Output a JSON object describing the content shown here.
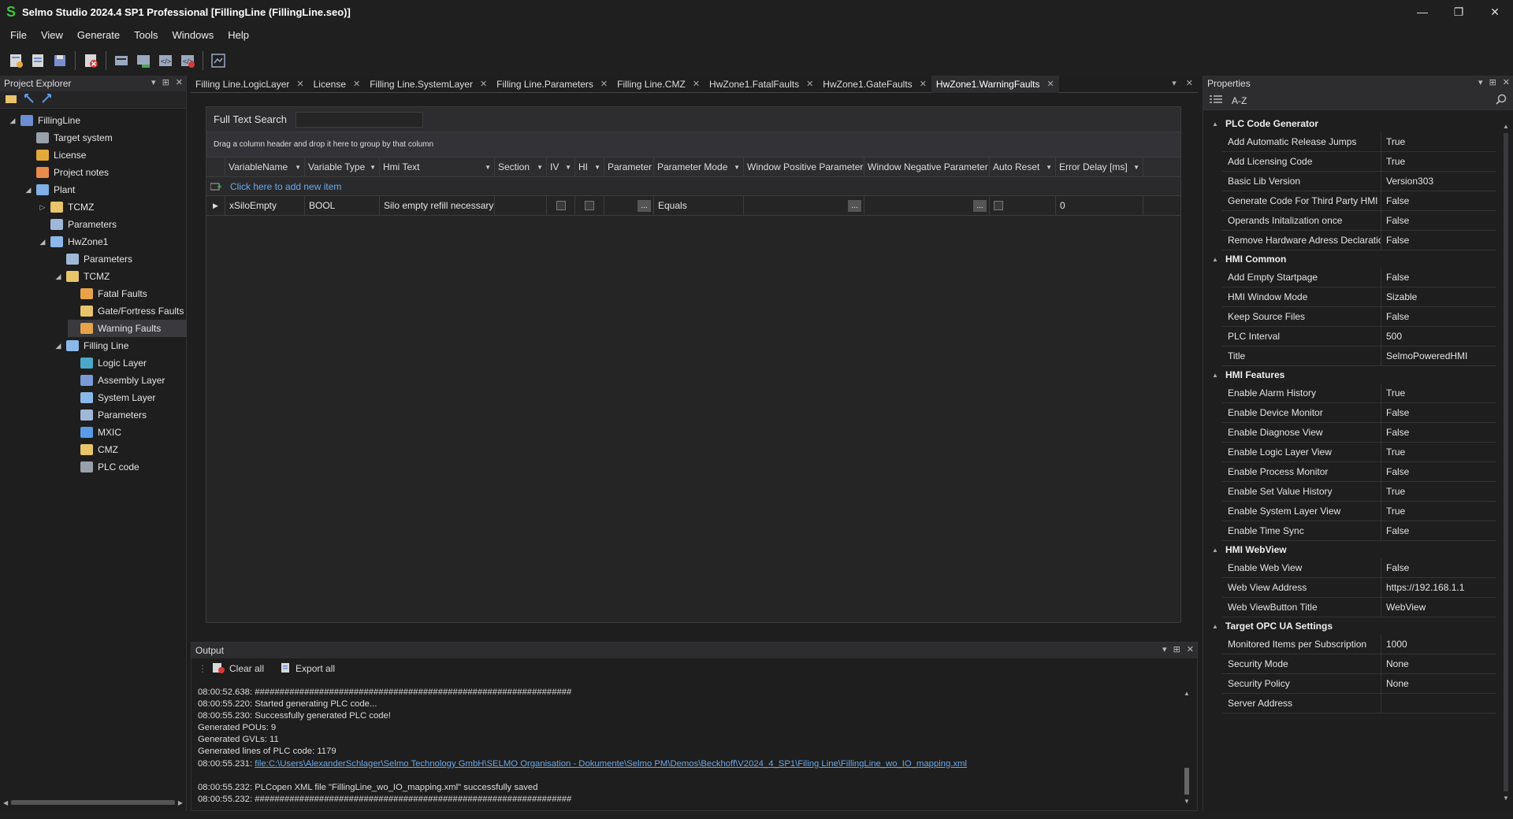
{
  "titlebar": {
    "title": "Selmo Studio 2024.4 SP1 Professional  [FillingLine (FillingLine.seo)]",
    "logo": "S"
  },
  "menu": [
    "File",
    "View",
    "Generate",
    "Tools",
    "Windows",
    "Help"
  ],
  "project_explorer": {
    "title": "Project Explorer",
    "tree": [
      {
        "label": "FillingLine",
        "level": 0,
        "exp": "◢",
        "icon": "project-icon",
        "color": "#6c8fd4"
      },
      {
        "label": "Target system",
        "level": 1,
        "exp": "",
        "icon": "target-system-icon",
        "color": "#9aa0aa"
      },
      {
        "label": "License",
        "level": 1,
        "exp": "",
        "icon": "key-icon",
        "color": "#e3a93a"
      },
      {
        "label": "Project notes",
        "level": 1,
        "exp": "",
        "icon": "notes-icon",
        "color": "#e88a4a"
      },
      {
        "label": "Plant",
        "level": 1,
        "exp": "◢",
        "icon": "plant-icon",
        "color": "#7fb0e6"
      },
      {
        "label": "TCMZ",
        "level": 2,
        "exp": "▷",
        "icon": "folder-icon",
        "color": "#e8c46a"
      },
      {
        "label": "Parameters",
        "level": 2,
        "exp": "",
        "icon": "parameters-icon",
        "color": "#9fb8d8"
      },
      {
        "label": "HwZone1",
        "level": 2,
        "exp": "◢",
        "icon": "zone-icon",
        "color": "#8ab8e8"
      },
      {
        "label": "Parameters",
        "level": 3,
        "exp": "",
        "icon": "parameters-icon",
        "color": "#9fb8d8"
      },
      {
        "label": "TCMZ",
        "level": 3,
        "exp": "◢",
        "icon": "folder-icon",
        "color": "#e8c46a"
      },
      {
        "label": "Fatal Faults",
        "level": 4,
        "exp": "",
        "icon": "fatal-faults-icon",
        "color": "#e8a24a"
      },
      {
        "label": "Gate/Fortress Faults",
        "level": 4,
        "exp": "",
        "icon": "gate-faults-icon",
        "color": "#e8c46a"
      },
      {
        "label": "Warning Faults",
        "level": 4,
        "exp": "",
        "icon": "warning-faults-icon",
        "color": "#e8a24a",
        "selected": true
      },
      {
        "label": "Filling Line",
        "level": 3,
        "exp": "◢",
        "icon": "line-icon",
        "color": "#8ab8e8"
      },
      {
        "label": "Logic Layer",
        "level": 4,
        "exp": "",
        "icon": "logic-layer-icon",
        "color": "#4aa8c8"
      },
      {
        "label": "Assembly Layer",
        "level": 4,
        "exp": "",
        "icon": "assembly-layer-icon",
        "color": "#7a9ad8"
      },
      {
        "label": "System Layer",
        "level": 4,
        "exp": "",
        "icon": "system-layer-icon",
        "color": "#8ab8e8"
      },
      {
        "label": "Parameters",
        "level": 4,
        "exp": "",
        "icon": "parameters-icon",
        "color": "#9fb8d8"
      },
      {
        "label": "MXIC",
        "level": 4,
        "exp": "",
        "icon": "mxic-icon",
        "color": "#5a9ae8"
      },
      {
        "label": "CMZ",
        "level": 4,
        "exp": "",
        "icon": "folder-icon",
        "color": "#e8c46a"
      },
      {
        "label": "PLC code",
        "level": 4,
        "exp": "",
        "icon": "plc-code-icon",
        "color": "#9aa0aa"
      }
    ]
  },
  "tabs": [
    {
      "label": "Filling Line.LogicLayer"
    },
    {
      "label": "License"
    },
    {
      "label": "Filling Line.SystemLayer"
    },
    {
      "label": "Filling Line.Parameters"
    },
    {
      "label": "Filling Line.CMZ"
    },
    {
      "label": "HwZone1.FatalFaults"
    },
    {
      "label": "HwZone1.GateFaults"
    },
    {
      "label": "HwZone1.WarningFaults",
      "active": true
    }
  ],
  "grid": {
    "search_label": "Full Text Search",
    "group_hint": "Drag a column header and drop it here to group by that column",
    "add_label": "Click here to add new item",
    "columns": [
      "VariableName",
      "Variable Type",
      "Hmi Text",
      "Section",
      "IV",
      "HI",
      "Parameter",
      "Parameter Mode",
      "Window Positive Parameter",
      "Window Negative Parameter",
      "Auto Reset",
      "Error Delay [ms]"
    ],
    "row": {
      "variable_name": "xSiloEmpty",
      "variable_type": "BOOL",
      "hmi_text": "Silo empty refill necessary",
      "parameter_mode": "Equals",
      "error_delay": "0",
      "dots": "..."
    }
  },
  "output": {
    "title": "Output",
    "clear_all": "Clear all",
    "export_all": "Export all",
    "lines": [
      {
        "text": "08:00:52.638: ################################################################"
      },
      {
        "text": "08:00:55.220: Started generating PLC code..."
      },
      {
        "text": "08:00:55.230: Successfully generated PLC code!"
      },
      {
        "text": "Generated POUs: 9"
      },
      {
        "text": "Generated GVLs: 11"
      },
      {
        "text": "Generated lines of PLC code: 1179"
      },
      {
        "text": "08:00:55.231: ",
        "link": "file:C:\\Users\\AlexanderSchlager\\Selmo Technology GmbH\\SELMO Organisation - Dokumente\\Selmo PM\\Demos\\Beckhoff\\V2024_4_SP1\\Filing Line\\FillingLine_wo_IO_mapping.xml"
      },
      {
        "text": ""
      },
      {
        "text": "08:00:55.232: PLCopen XML file \"FillingLine_wo_IO_mapping.xml\" successfully saved"
      },
      {
        "text": "08:00:55.232: ################################################################"
      }
    ]
  },
  "properties": {
    "title": "Properties",
    "sort_label": "A-Z",
    "categories": [
      {
        "name": "PLC Code Generator",
        "rows": [
          [
            "Add Automatic Release Jumps",
            "True"
          ],
          [
            "Add Licensing Code",
            "True"
          ],
          [
            "Basic Lib Version",
            "Version303"
          ],
          [
            "Generate Code For Third Party HMI",
            "False"
          ],
          [
            "Operands Initalization once",
            "False"
          ],
          [
            "Remove Hardware Adress Declaration",
            "False"
          ]
        ]
      },
      {
        "name": "HMI Common",
        "rows": [
          [
            "Add Empty Startpage",
            "False"
          ],
          [
            "HMI Window Mode",
            "Sizable"
          ],
          [
            "Keep Source Files",
            "False"
          ],
          [
            "PLC Interval",
            "500"
          ],
          [
            "Title",
            "SelmoPoweredHMI"
          ]
        ]
      },
      {
        "name": "HMI Features",
        "rows": [
          [
            "Enable Alarm History",
            "True"
          ],
          [
            "Enable Device Monitor",
            "False"
          ],
          [
            "Enable Diagnose View",
            "False"
          ],
          [
            "Enable Logic Layer View",
            "True"
          ],
          [
            "Enable Process Monitor",
            "False"
          ],
          [
            "Enable Set Value History",
            "True"
          ],
          [
            "Enable System Layer View",
            "True"
          ],
          [
            "Enable Time Sync",
            "False"
          ]
        ]
      },
      {
        "name": "HMI WebView",
        "rows": [
          [
            "Enable Web View",
            "False"
          ],
          [
            "Web View Address",
            "https://192.168.1.1"
          ],
          [
            "Web ViewButton Title",
            "WebView"
          ]
        ]
      },
      {
        "name": "Target OPC UA Settings",
        "rows": [
          [
            "Monitored Items per Subscription",
            "1000"
          ],
          [
            "Security Mode",
            "None"
          ],
          [
            "Security Policy",
            "None"
          ],
          [
            "Server Address",
            ""
          ]
        ]
      }
    ]
  }
}
